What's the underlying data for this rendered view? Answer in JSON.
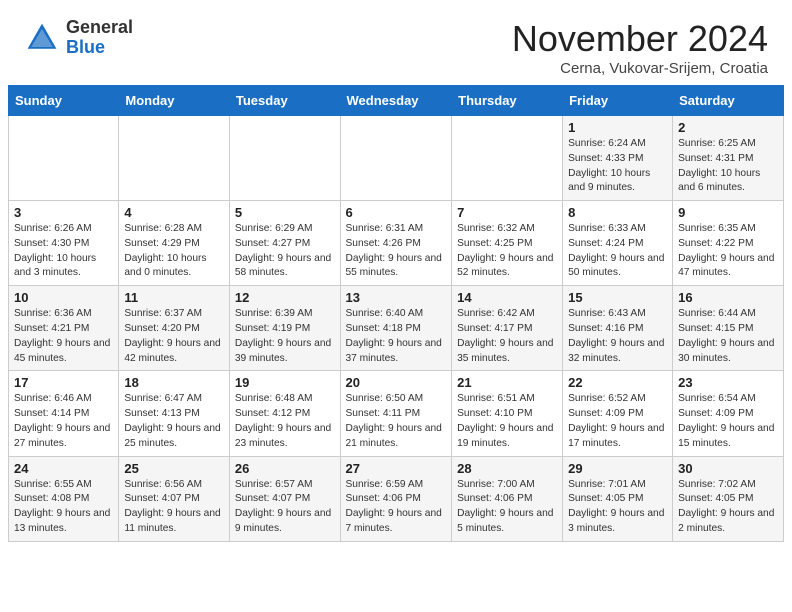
{
  "header": {
    "logo_general": "General",
    "logo_blue": "Blue",
    "month_title": "November 2024",
    "subtitle": "Cerna, Vukovar-Srijem, Croatia"
  },
  "days_of_week": [
    "Sunday",
    "Monday",
    "Tuesday",
    "Wednesday",
    "Thursday",
    "Friday",
    "Saturday"
  ],
  "weeks": [
    [
      {
        "day": "",
        "info": ""
      },
      {
        "day": "",
        "info": ""
      },
      {
        "day": "",
        "info": ""
      },
      {
        "day": "",
        "info": ""
      },
      {
        "day": "",
        "info": ""
      },
      {
        "day": "1",
        "info": "Sunrise: 6:24 AM\nSunset: 4:33 PM\nDaylight: 10 hours and 9 minutes."
      },
      {
        "day": "2",
        "info": "Sunrise: 6:25 AM\nSunset: 4:31 PM\nDaylight: 10 hours and 6 minutes."
      }
    ],
    [
      {
        "day": "3",
        "info": "Sunrise: 6:26 AM\nSunset: 4:30 PM\nDaylight: 10 hours and 3 minutes."
      },
      {
        "day": "4",
        "info": "Sunrise: 6:28 AM\nSunset: 4:29 PM\nDaylight: 10 hours and 0 minutes."
      },
      {
        "day": "5",
        "info": "Sunrise: 6:29 AM\nSunset: 4:27 PM\nDaylight: 9 hours and 58 minutes."
      },
      {
        "day": "6",
        "info": "Sunrise: 6:31 AM\nSunset: 4:26 PM\nDaylight: 9 hours and 55 minutes."
      },
      {
        "day": "7",
        "info": "Sunrise: 6:32 AM\nSunset: 4:25 PM\nDaylight: 9 hours and 52 minutes."
      },
      {
        "day": "8",
        "info": "Sunrise: 6:33 AM\nSunset: 4:24 PM\nDaylight: 9 hours and 50 minutes."
      },
      {
        "day": "9",
        "info": "Sunrise: 6:35 AM\nSunset: 4:22 PM\nDaylight: 9 hours and 47 minutes."
      }
    ],
    [
      {
        "day": "10",
        "info": "Sunrise: 6:36 AM\nSunset: 4:21 PM\nDaylight: 9 hours and 45 minutes."
      },
      {
        "day": "11",
        "info": "Sunrise: 6:37 AM\nSunset: 4:20 PM\nDaylight: 9 hours and 42 minutes."
      },
      {
        "day": "12",
        "info": "Sunrise: 6:39 AM\nSunset: 4:19 PM\nDaylight: 9 hours and 39 minutes."
      },
      {
        "day": "13",
        "info": "Sunrise: 6:40 AM\nSunset: 4:18 PM\nDaylight: 9 hours and 37 minutes."
      },
      {
        "day": "14",
        "info": "Sunrise: 6:42 AM\nSunset: 4:17 PM\nDaylight: 9 hours and 35 minutes."
      },
      {
        "day": "15",
        "info": "Sunrise: 6:43 AM\nSunset: 4:16 PM\nDaylight: 9 hours and 32 minutes."
      },
      {
        "day": "16",
        "info": "Sunrise: 6:44 AM\nSunset: 4:15 PM\nDaylight: 9 hours and 30 minutes."
      }
    ],
    [
      {
        "day": "17",
        "info": "Sunrise: 6:46 AM\nSunset: 4:14 PM\nDaylight: 9 hours and 27 minutes."
      },
      {
        "day": "18",
        "info": "Sunrise: 6:47 AM\nSunset: 4:13 PM\nDaylight: 9 hours and 25 minutes."
      },
      {
        "day": "19",
        "info": "Sunrise: 6:48 AM\nSunset: 4:12 PM\nDaylight: 9 hours and 23 minutes."
      },
      {
        "day": "20",
        "info": "Sunrise: 6:50 AM\nSunset: 4:11 PM\nDaylight: 9 hours and 21 minutes."
      },
      {
        "day": "21",
        "info": "Sunrise: 6:51 AM\nSunset: 4:10 PM\nDaylight: 9 hours and 19 minutes."
      },
      {
        "day": "22",
        "info": "Sunrise: 6:52 AM\nSunset: 4:09 PM\nDaylight: 9 hours and 17 minutes."
      },
      {
        "day": "23",
        "info": "Sunrise: 6:54 AM\nSunset: 4:09 PM\nDaylight: 9 hours and 15 minutes."
      }
    ],
    [
      {
        "day": "24",
        "info": "Sunrise: 6:55 AM\nSunset: 4:08 PM\nDaylight: 9 hours and 13 minutes."
      },
      {
        "day": "25",
        "info": "Sunrise: 6:56 AM\nSunset: 4:07 PM\nDaylight: 9 hours and 11 minutes."
      },
      {
        "day": "26",
        "info": "Sunrise: 6:57 AM\nSunset: 4:07 PM\nDaylight: 9 hours and 9 minutes."
      },
      {
        "day": "27",
        "info": "Sunrise: 6:59 AM\nSunset: 4:06 PM\nDaylight: 9 hours and 7 minutes."
      },
      {
        "day": "28",
        "info": "Sunrise: 7:00 AM\nSunset: 4:06 PM\nDaylight: 9 hours and 5 minutes."
      },
      {
        "day": "29",
        "info": "Sunrise: 7:01 AM\nSunset: 4:05 PM\nDaylight: 9 hours and 3 minutes."
      },
      {
        "day": "30",
        "info": "Sunrise: 7:02 AM\nSunset: 4:05 PM\nDaylight: 9 hours and 2 minutes."
      }
    ]
  ]
}
